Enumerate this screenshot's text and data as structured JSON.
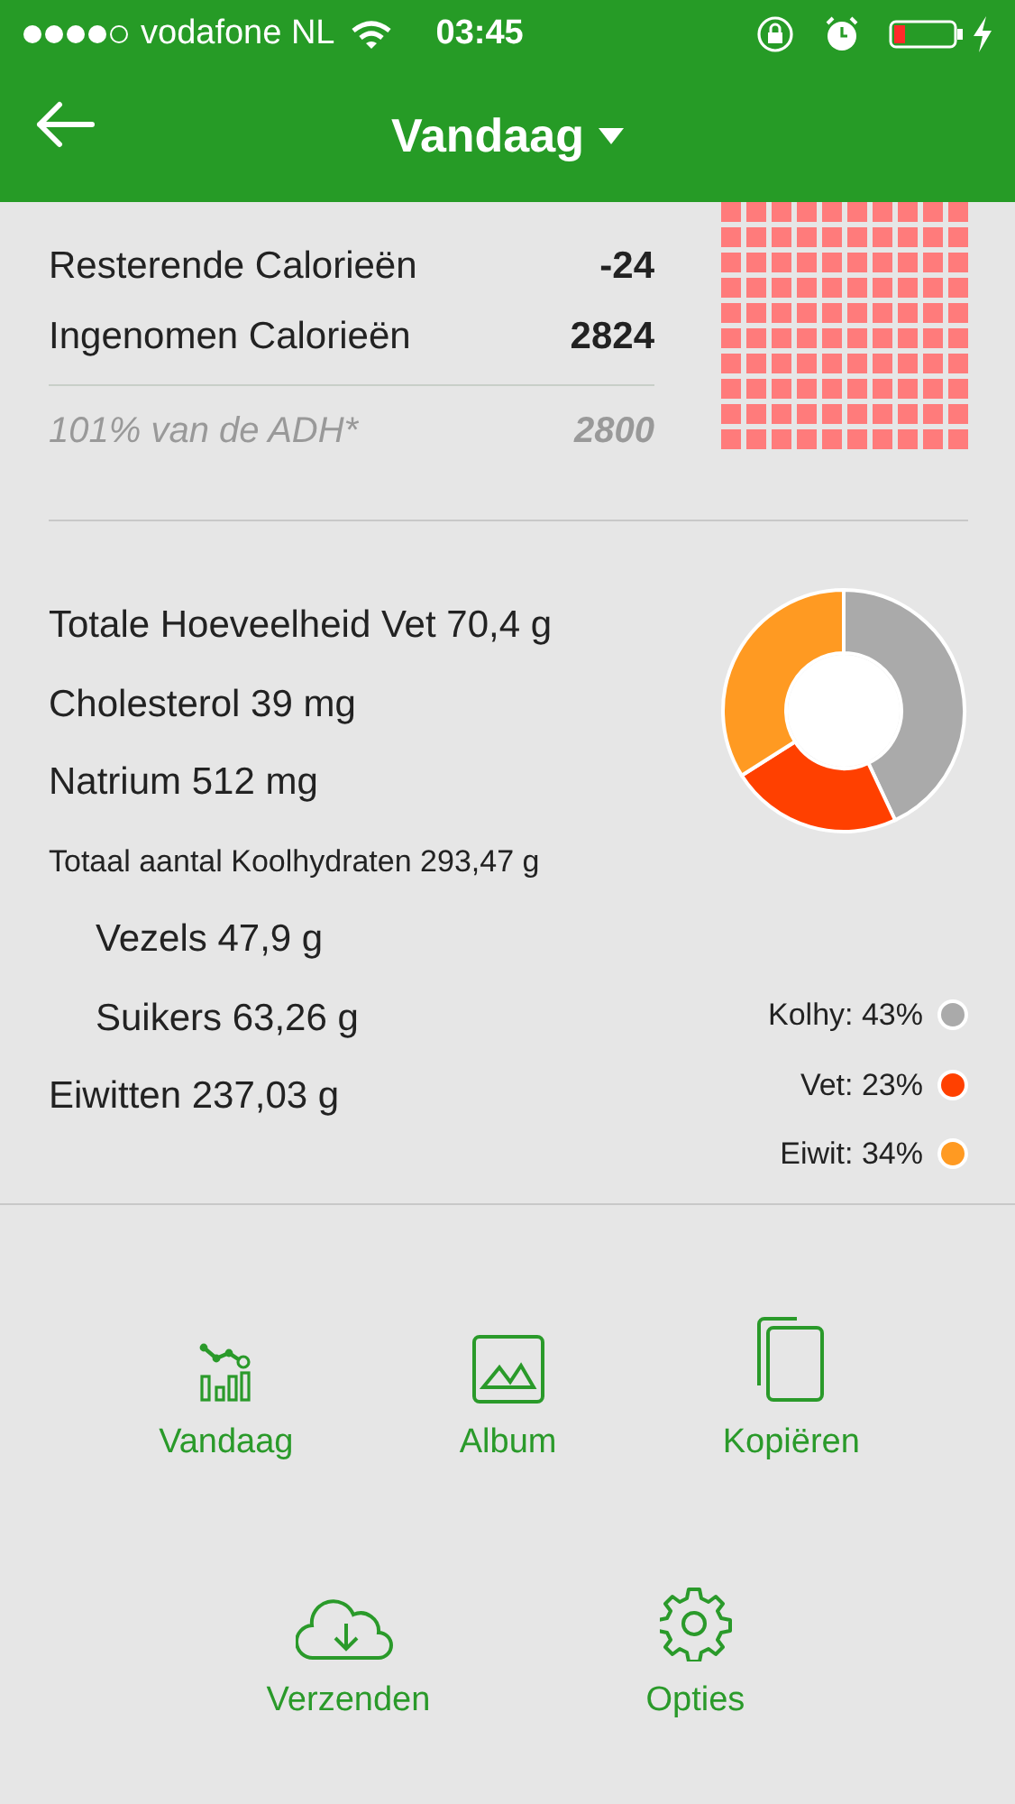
{
  "status_bar": {
    "carrier": "vodafone NL",
    "time": "03:45"
  },
  "header": {
    "title": "Vandaag"
  },
  "calories": {
    "rows": [
      {
        "label": "Resterende Calorieën",
        "value": "-24"
      },
      {
        "label": "Ingenomen Calorieën",
        "value": "2824"
      }
    ],
    "goal": {
      "label": "101% van de ADH*",
      "value": "2800"
    }
  },
  "nutrients": [
    {
      "text": "Totale Hoeveelheid Vet 70,4 g"
    },
    {
      "text": "Cholesterol 39 mg"
    },
    {
      "text": "Natrium 512 mg"
    },
    {
      "text": "Totaal aantal Koolhydraten 293,47 g",
      "children": [
        {
          "text": "Vezels 47,9 g"
        },
        {
          "text": "Suikers 63,26 g"
        }
      ]
    },
    {
      "text": "Eiwitten 237,03 g"
    }
  ],
  "macro_chart": {
    "chart_data": {
      "type": "donut",
      "series": [
        {
          "values": [
            43,
            23,
            34
          ]
        }
      ],
      "colors": [
        "#aaaaaa",
        "#ff4000",
        "#ff9a22"
      ],
      "value_labels": [
        "Kolhy: 43%",
        "Vet: 23%",
        "Eiwit: 34%"
      ]
    }
  },
  "actions": [
    [
      {
        "label": "Vandaag"
      },
      {
        "label": "Album"
      },
      {
        "label": "Kopiëren"
      }
    ],
    [
      {
        "label": "Verzenden"
      },
      {
        "label": "Opties"
      }
    ]
  ]
}
